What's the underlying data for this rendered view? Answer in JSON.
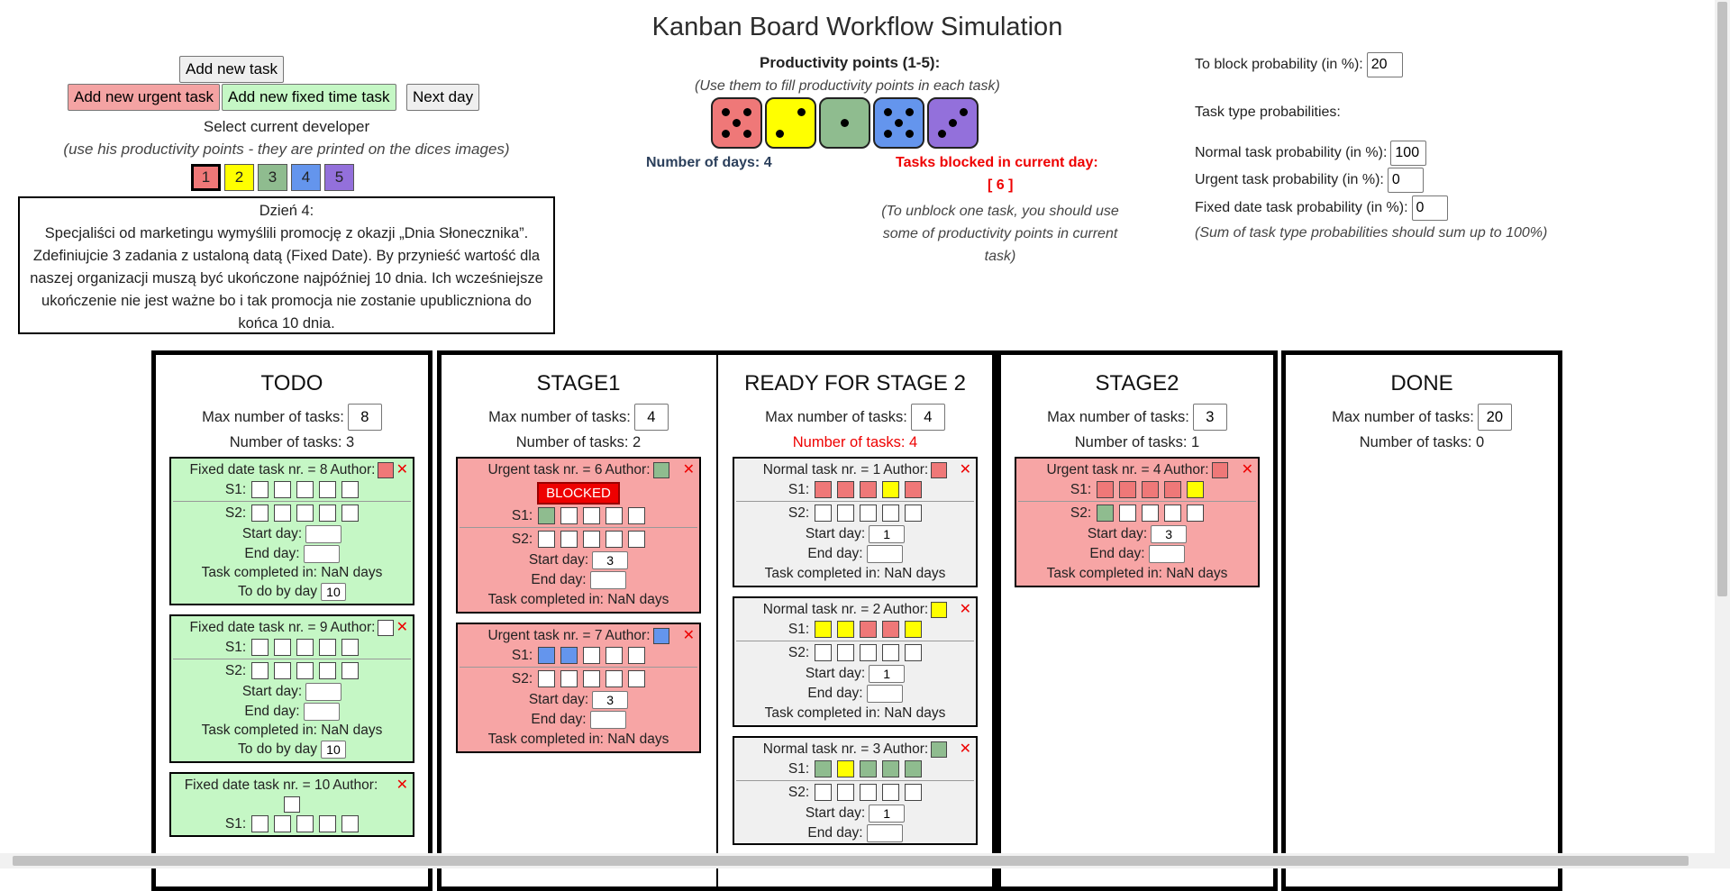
{
  "page_title": "Kanban Board Workflow Simulation",
  "controls": {
    "add_task": "Add new task",
    "add_urgent": "Add new urgent task",
    "add_fixed": "Add new fixed time task",
    "next_day": "Next day",
    "select_dev": "Select current developer",
    "select_dev_note": "(use his productivity points - they are printed on the dices images)",
    "developers": [
      "1",
      "2",
      "3",
      "4",
      "5"
    ],
    "selected_developer": "1"
  },
  "story": {
    "day": "Dzień 4:",
    "text": "Specjaliści od marketingu wymyślili promocję z okazji „Dnia Słonecznika”. Zdefiniujcie 3 zadania z ustaloną datą (Fixed Date). By przynieść wartość dla naszej organizacji muszą być ukończone najpóźniej 10 dnia. Ich wcześniejsze ukończenie nie jest ważne bo i tak promocja nie zostanie upubliczniona do końca 10 dnia."
  },
  "productivity": {
    "title": "Productivity points (1-5):",
    "note": "(Use them to fill productivity points in each task)",
    "dice": [
      {
        "color": "#ef7878",
        "value": 5
      },
      {
        "color": "#ffff00",
        "value": 2
      },
      {
        "color": "#8fbc8f",
        "value": 1
      },
      {
        "color": "#6495ed",
        "value": 5
      },
      {
        "color": "#9370db",
        "value": 3
      }
    ],
    "days": "Number of days: 4",
    "blocked_title": "Tasks blocked in current day:",
    "blocked_list": "[ 6 ]",
    "unblock_note": "(To unblock one task, you should use some of productivity points in current task)"
  },
  "settings": {
    "block_label": "To block probability (in %):",
    "block_value": "20",
    "type_title": "Task type probabilities:",
    "normal_label": "Normal task probability (in %):",
    "normal_value": "100",
    "urgent_label": "Urgent task probability (in %):",
    "urgent_value": "0",
    "fixed_label": "Fixed date task probability (in %):",
    "fixed_value": "0",
    "sum_note": "(Sum of task type probabilities should sum up to 100%)"
  },
  "labels": {
    "max": "Max number of tasks:",
    "s1": "S1:",
    "s2": "S2:",
    "start": "Start day:",
    "end": "End day:",
    "completed": "Task completed in: NaN days",
    "todo_by": "To do by day",
    "blocked": "BLOCKED"
  },
  "columns": {
    "todo": {
      "title": "TODO",
      "max": "8",
      "count": "Number of tasks: 3"
    },
    "stage1": {
      "title": "STAGE1",
      "max": "4",
      "count": "Number of tasks: 2"
    },
    "ready2": {
      "title": "READY FOR STAGE 2",
      "max": "4",
      "count": "Number of tasks: 4"
    },
    "stage2": {
      "title": "STAGE2",
      "max": "3",
      "count": "Number of tasks: 1"
    },
    "done": {
      "title": "DONE",
      "max": "20",
      "count": "Number of tasks: 0"
    }
  },
  "cards": {
    "t8": {
      "title": "Fixed date task nr. = 8",
      "author": "Author:",
      "due": "10"
    },
    "t9": {
      "title": "Fixed date task nr. = 9",
      "author": "Author:",
      "due": "10"
    },
    "t10": {
      "title": "Fixed date task nr. = 10",
      "author": "Author:"
    },
    "u6": {
      "title": "Urgent task nr. = 6",
      "author": "Author:",
      "start": "3"
    },
    "u7": {
      "title": "Urgent task nr. = 7",
      "author": "Author:",
      "start": "3"
    },
    "n1": {
      "title": "Normal task nr. = 1",
      "author": "Author:",
      "start": "1"
    },
    "n2": {
      "title": "Normal task nr. = 2",
      "author": "Author:",
      "start": "1"
    },
    "n3": {
      "title": "Normal task nr. = 3",
      "author": "Author:",
      "start": "1"
    },
    "u4": {
      "title": "Urgent task nr. = 4",
      "author": "Author:",
      "start": "3"
    }
  }
}
